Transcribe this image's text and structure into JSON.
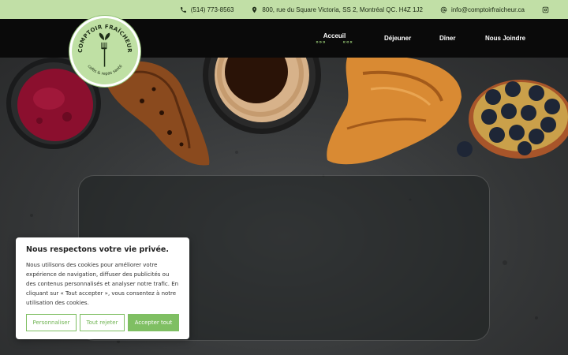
{
  "topbar": {
    "phone": "(514) 773-8563",
    "address": "800, rue du Square Victoria, SS 2, Montréal QC. H4Z 1J2",
    "email": "info@comptoirfraicheur.ca",
    "icons": [
      "phone-icon",
      "map-pin-icon",
      "at-icon",
      "instagram-icon"
    ]
  },
  "logo": {
    "title": "COMPTOIR FRAÎCHEUR",
    "subtitle": "cafés & repas santé"
  },
  "nav": {
    "items": [
      {
        "label": "Acceuil",
        "active": true,
        "deco_left": "»»»",
        "deco_right": "«««"
      },
      {
        "label": "Déjeuner",
        "active": false
      },
      {
        "label": "Dîner",
        "active": false
      },
      {
        "label": "Nous Joindre",
        "active": false
      }
    ]
  },
  "cookie": {
    "title": "Nous respectons votre vie privée.",
    "body": "Nous utilisons des cookies pour améliorer votre expérience de navigation, diffuser des publicités ou des contenus personnalisés et analyser notre trafic. En cliquant sur « Tout accepter », vous consentez à notre utilisation des cookies.",
    "customize_label": "Personnaliser",
    "reject_label": "Tout rejeter",
    "accept_label": "Accepter tout"
  },
  "colors": {
    "topbar_bg": "#c1dfa6",
    "navbar_bg": "#0a0a0a",
    "accent_green": "#7fbf63"
  }
}
